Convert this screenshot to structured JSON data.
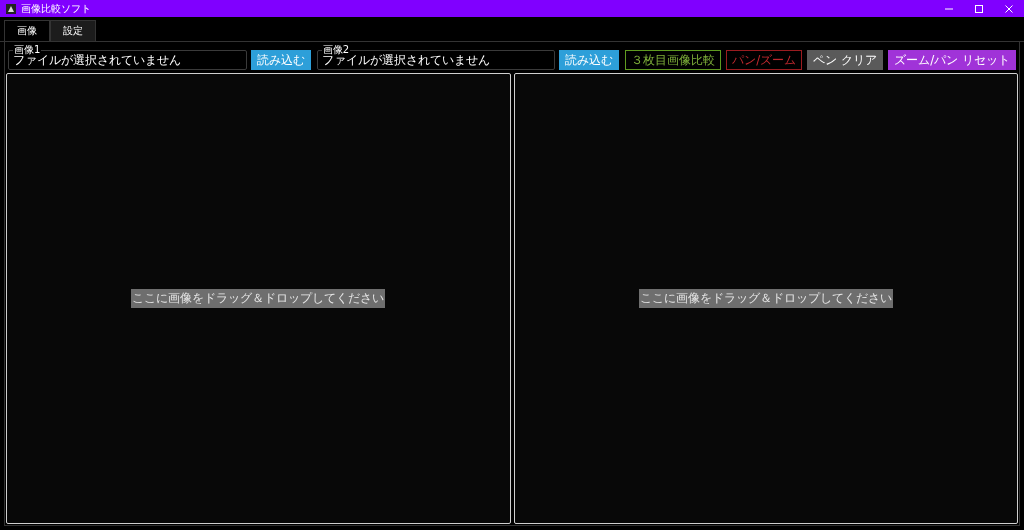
{
  "window": {
    "title": "画像比較ソフト"
  },
  "tabs": [
    {
      "label": "画像",
      "selected": true
    },
    {
      "label": "設定",
      "selected": false
    }
  ],
  "file_fields": [
    {
      "label": "画像1",
      "value": "ファイルが選択されていません",
      "button": "読み込む"
    },
    {
      "label": "画像2",
      "value": "ファイルが選択されていません",
      "button": "読み込む"
    }
  ],
  "toolbar_buttons": [
    {
      "label": "３枚目画像比較",
      "kind": "green-outline"
    },
    {
      "label": "パン/ズーム",
      "kind": "red-outline"
    },
    {
      "label": "ペン クリア",
      "kind": "gray"
    },
    {
      "label": "ズーム/パン リセット",
      "kind": "purple"
    }
  ],
  "panels": [
    {
      "hint": "ここに画像をドラッグ＆ドロップしてください"
    },
    {
      "hint": "ここに画像をドラッグ＆ドロップしてください"
    }
  ]
}
